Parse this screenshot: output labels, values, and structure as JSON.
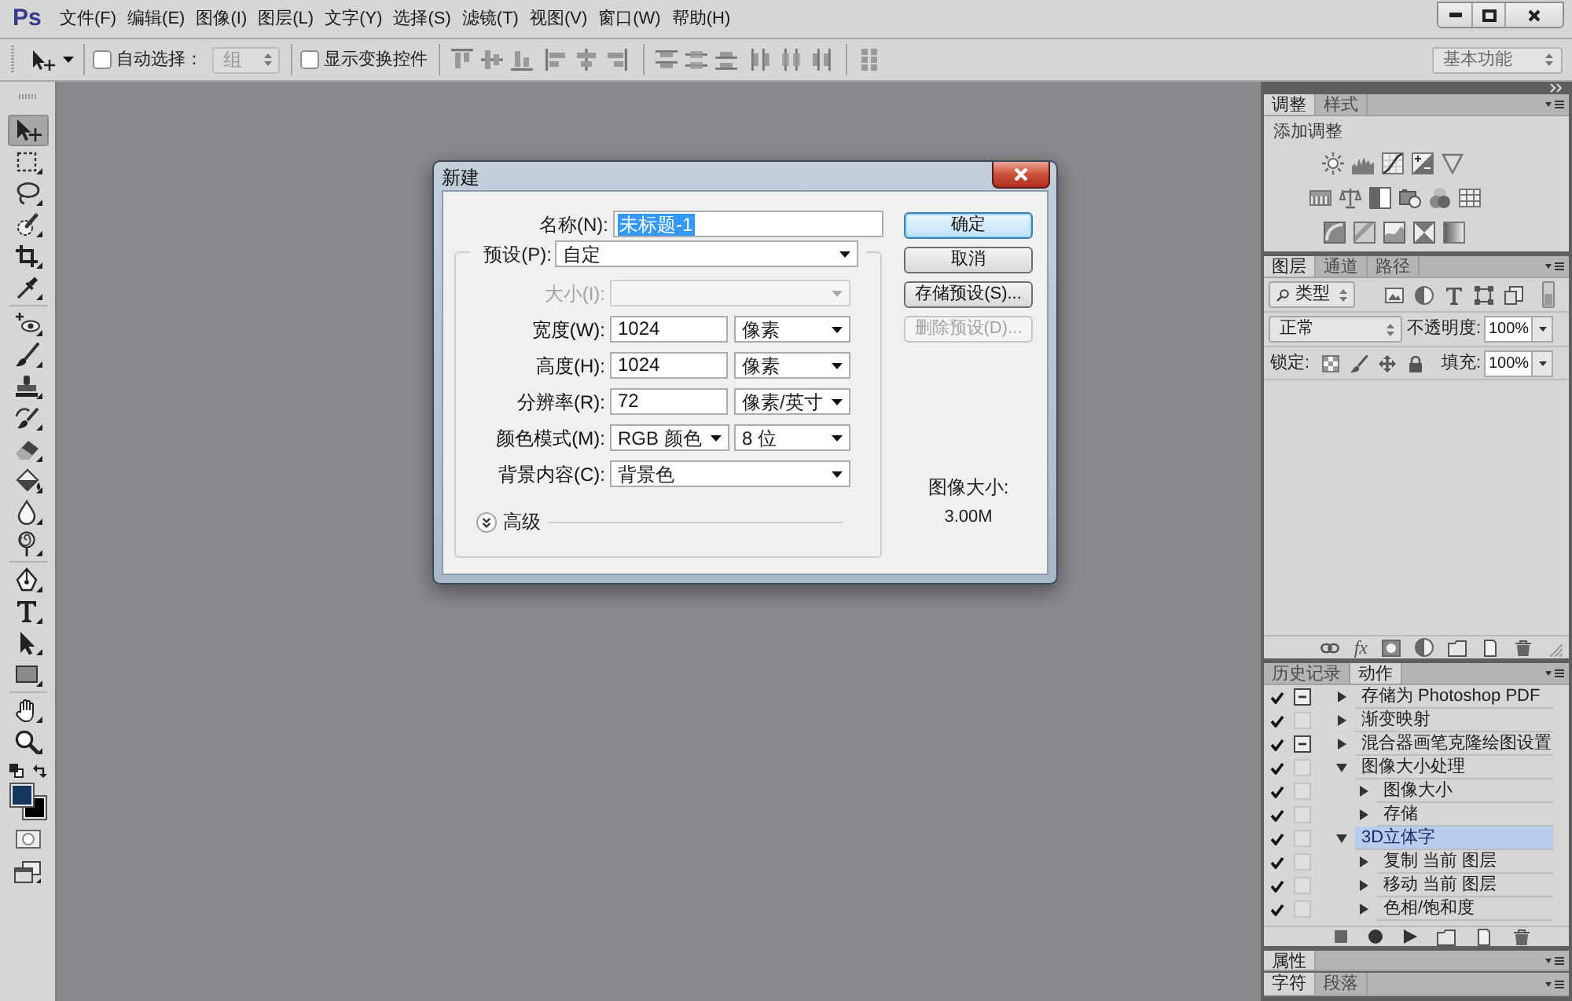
{
  "menu_bar": {
    "logo": "Ps",
    "items": [
      "文件(F)",
      "编辑(E)",
      "图像(I)",
      "图层(L)",
      "文字(Y)",
      "选择(S)",
      "滤镜(T)",
      "视图(V)",
      "窗口(W)",
      "帮助(H)"
    ]
  },
  "options_bar": {
    "auto_select": {
      "label": "自动选择：",
      "checked": false
    },
    "auto_select_target": {
      "value": "组",
      "disabled": true
    },
    "transform_controls": {
      "label": "显示变换控件",
      "checked": false
    },
    "workspace": "基本功能"
  },
  "toolbox": {
    "tool_groups": [
      {
        "tools": [
          {
            "kind": "move",
            "selected": true
          },
          {
            "kind": "marquee",
            "selected": false
          },
          {
            "kind": "lasso",
            "selected": false
          },
          {
            "kind": "quick_select",
            "selected": false
          },
          {
            "kind": "crop",
            "selected": false
          },
          {
            "kind": "eyedropper",
            "selected": false
          }
        ]
      },
      {
        "tools": [
          {
            "kind": "healing",
            "selected": false
          },
          {
            "kind": "brush",
            "selected": false
          },
          {
            "kind": "stamp",
            "selected": false
          },
          {
            "kind": "history_brush",
            "selected": false
          },
          {
            "kind": "eraser",
            "selected": false
          },
          {
            "kind": "bucket",
            "selected": false
          },
          {
            "kind": "blur",
            "selected": false
          },
          {
            "kind": "dodge",
            "selected": false
          }
        ]
      },
      {
        "tools": [
          {
            "kind": "pen",
            "selected": false
          },
          {
            "kind": "type",
            "selected": false
          },
          {
            "kind": "path_select",
            "selected": false
          },
          {
            "kind": "shape",
            "selected": false
          }
        ]
      },
      {
        "tools": [
          {
            "kind": "hand",
            "selected": false
          },
          {
            "kind": "zoom",
            "selected": false
          }
        ]
      }
    ],
    "swatches": [
      {
        "kind": "background",
        "color": "#000000"
      },
      {
        "kind": "foreground",
        "color": "#14395f"
      }
    ]
  },
  "dialog": {
    "title": "新建",
    "name_field": {
      "label": "名称(N):",
      "value": "未标题-1",
      "text_selected": true
    },
    "preset": {
      "label": "预设(P):",
      "value": "自定"
    },
    "rows": [
      {
        "kind": "select",
        "label": "大小(I):",
        "disabled": true
      },
      {
        "kind": "input_unit",
        "label": "宽度(W):",
        "value": "1024",
        "unit": "像素",
        "disabled": false
      },
      {
        "kind": "input_unit",
        "label": "高度(H):",
        "value": "1024",
        "unit": "像素",
        "disabled": false
      },
      {
        "kind": "input_unit",
        "label": "分辨率(R):",
        "value": "72",
        "unit": "像素/英寸",
        "disabled": false
      },
      {
        "kind": "select_pair",
        "label": "颜色模式(M):",
        "value": "RGB 颜色",
        "unit": "8 位",
        "disabled": false
      },
      {
        "kind": "select",
        "label": "背景内容(C):",
        "value": "背景色",
        "disabled": false
      }
    ],
    "advanced": {
      "label": "高级",
      "expanded": false
    },
    "buttons": [
      {
        "label": "确定",
        "default": true,
        "disabled": false
      },
      {
        "label": "取消",
        "default": false,
        "disabled": false
      },
      {
        "label": "存储预设(S)...",
        "default": false,
        "disabled": false
      },
      {
        "label": "删除预设(D)...",
        "default": false,
        "disabled": true
      }
    ],
    "image_size": {
      "label": "图像大小:",
      "value": "3.00M"
    }
  },
  "adjustments_panel": {
    "tabs": [
      {
        "label": "调整",
        "selected": true
      },
      {
        "label": "样式",
        "selected": false
      }
    ],
    "heading": "添加调整"
  },
  "layers_panel": {
    "tabs": [
      {
        "label": "图层",
        "selected": true
      },
      {
        "label": "通道",
        "selected": false
      },
      {
        "label": "路径",
        "selected": false
      }
    ],
    "filter": "类型",
    "blend_mode": "正常",
    "opacity": {
      "label": "不透明度:",
      "value": "100%"
    },
    "lock_label": "锁定:",
    "fill": {
      "label": "填充:",
      "value": "100%"
    },
    "effects_button": "fx"
  },
  "actions_panel": {
    "tabs": [
      {
        "label": "历史记录",
        "selected": false
      },
      {
        "label": "动作",
        "selected": true
      }
    ],
    "actions": [
      {
        "label": "存储为 Photoshop PDF",
        "checked": true,
        "dialog": true,
        "expanded": false,
        "selected": false
      },
      {
        "label": "渐变映射",
        "checked": true,
        "dialog": false,
        "expanded": false,
        "selected": false
      },
      {
        "label": "混合器画笔克隆绘图设置",
        "checked": true,
        "dialog": true,
        "expanded": false,
        "selected": false
      },
      {
        "label": "图像大小处理",
        "checked": true,
        "dialog": false,
        "expanded": true,
        "selected": false,
        "children": [
          {
            "label": "图像大小",
            "checked": true,
            "dialog": false,
            "expanded": false,
            "selected": false
          },
          {
            "label": "存储",
            "checked": true,
            "dialog": false,
            "expanded": false,
            "selected": false
          }
        ]
      },
      {
        "label": "3D立体字",
        "checked": true,
        "dialog": false,
        "expanded": true,
        "selected": true,
        "children": [
          {
            "label": "复制 当前 图层",
            "checked": true,
            "dialog": false,
            "expanded": false,
            "selected": false
          },
          {
            "label": "移动 当前 图层",
            "checked": true,
            "dialog": false,
            "expanded": false,
            "selected": false
          },
          {
            "label": "色相/饱和度",
            "checked": true,
            "dialog": false,
            "expanded": false,
            "selected": false
          }
        ]
      }
    ]
  },
  "properties_panel": {
    "tabs": [
      {
        "label": "属性",
        "selected": true
      }
    ]
  },
  "character_panel": {
    "tabs": [
      {
        "label": "字符",
        "selected": true
      },
      {
        "label": "段落",
        "selected": false
      }
    ]
  }
}
